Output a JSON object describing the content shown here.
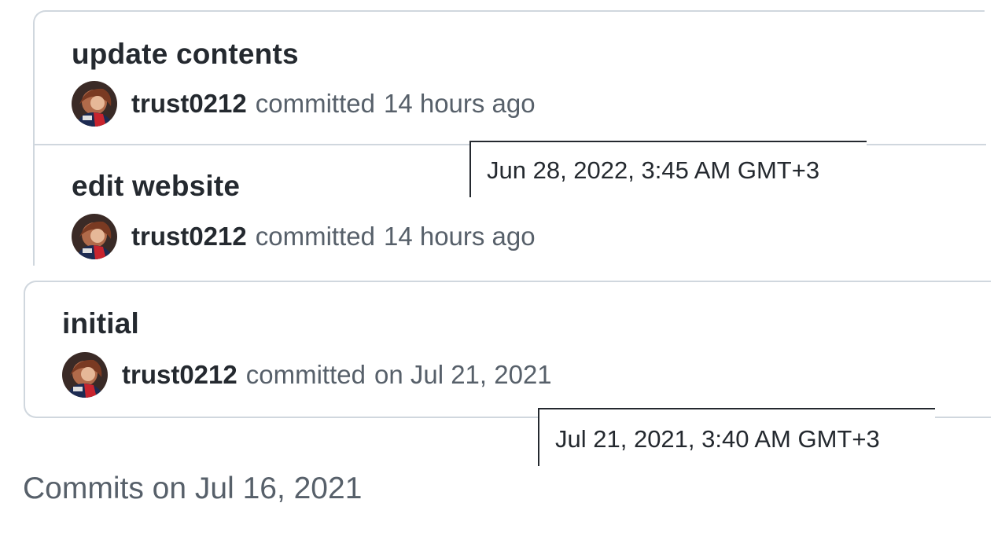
{
  "commits": [
    {
      "title": "update contents",
      "author": "trust0212",
      "action": "committed",
      "time": "14 hours ago"
    },
    {
      "title": "edit website",
      "author": "trust0212",
      "action": "committed",
      "time": "14 hours ago"
    },
    {
      "title": "initial",
      "author": "trust0212",
      "action": "committed",
      "time": "on Jul 21, 2021"
    }
  ],
  "tooltips": {
    "first": "Jun 28, 2022, 3:45 AM GMT+3",
    "second": "Jul 21, 2021, 3:40 AM GMT+3"
  },
  "next_group_heading": "Commits on Jul 16, 2021",
  "colors": {
    "border": "#d0d7de",
    "text_primary": "#24292f",
    "text_muted": "#57606a",
    "tooltip_border": "#24292f"
  },
  "icons": {
    "avatar": "user-avatar-icon"
  }
}
